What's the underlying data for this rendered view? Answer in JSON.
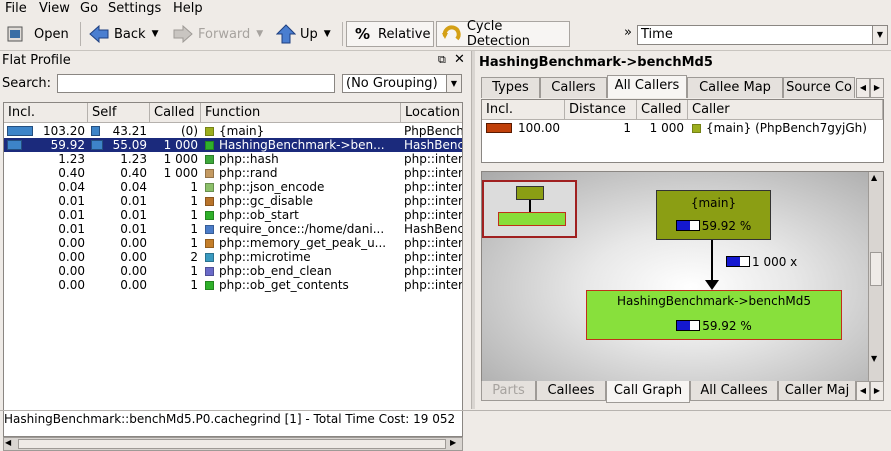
{
  "menu": [
    "File",
    "View",
    "Go",
    "Settings",
    "Help"
  ],
  "toolbar": {
    "open": "Open",
    "back": "Back",
    "forward": "Forward",
    "up": "Up",
    "relative": "Relative",
    "cycle": "Cycle Detection",
    "more": "»",
    "event_type": "Time"
  },
  "flat_profile": {
    "title": "Flat Profile",
    "search_label": "Search:",
    "search_value": "",
    "grouping": "(No Grouping)",
    "columns": [
      "Incl.",
      "Self",
      "Called",
      "Function",
      "Location"
    ],
    "rows": [
      {
        "incl": "103.20",
        "self": "43.21",
        "called": "(0)",
        "function": "{main}",
        "location": "PhpBench",
        "color": "#9cae1e",
        "incl_frac": 1.0,
        "self_frac": 0.42
      },
      {
        "incl": "59.92",
        "self": "55.09",
        "called": "1 000",
        "function": "HashingBenchmark->ben...",
        "location": "HashBench",
        "color": "#2fb02a",
        "incl_frac": 0.58,
        "self_frac": 0.53
      },
      {
        "incl": "1.23",
        "self": "1.23",
        "called": "1 000",
        "function": "php::hash",
        "location": "php::inter",
        "color": "#3da83a",
        "incl_frac": 0,
        "self_frac": 0
      },
      {
        "incl": "0.40",
        "self": "0.40",
        "called": "1 000",
        "function": "php::rand",
        "location": "php::inter",
        "color": "#c49a62",
        "incl_frac": 0,
        "self_frac": 0
      },
      {
        "incl": "0.04",
        "self": "0.04",
        "called": "1",
        "function": "php::json_encode",
        "location": "php::inter",
        "color": "#8cc06a",
        "incl_frac": 0,
        "self_frac": 0
      },
      {
        "incl": "0.01",
        "self": "0.01",
        "called": "1",
        "function": "php::gc_disable",
        "location": "php::inter",
        "color": "#b8732a",
        "incl_frac": 0,
        "self_frac": 0
      },
      {
        "incl": "0.01",
        "self": "0.01",
        "called": "1",
        "function": "php::ob_start",
        "location": "php::inter",
        "color": "#2fb02a",
        "incl_frac": 0,
        "self_frac": 0
      },
      {
        "incl": "0.01",
        "self": "0.01",
        "called": "1",
        "function": "require_once::/home/dani...",
        "location": "HashBench",
        "color": "#4a7cc8",
        "incl_frac": 0,
        "self_frac": 0
      },
      {
        "incl": "0.00",
        "self": "0.00",
        "called": "1",
        "function": "php::memory_get_peak_u...",
        "location": "php::inter",
        "color": "#c47e2a",
        "incl_frac": 0,
        "self_frac": 0
      },
      {
        "incl": "0.00",
        "self": "0.00",
        "called": "2",
        "function": "php::microtime",
        "location": "php::inter",
        "color": "#3a9ac0",
        "incl_frac": 0,
        "self_frac": 0
      },
      {
        "incl": "0.00",
        "self": "0.00",
        "called": "1",
        "function": "php::ob_end_clean",
        "location": "php::inter",
        "color": "#6a6ac8",
        "incl_frac": 0,
        "self_frac": 0
      },
      {
        "incl": "0.00",
        "self": "0.00",
        "called": "1",
        "function": "php::ob_get_contents",
        "location": "php::inter",
        "color": "#2fb02a",
        "incl_frac": 0,
        "self_frac": 0
      }
    ]
  },
  "detail": {
    "title": "HashingBenchmark->benchMd5",
    "tabs": [
      "Types",
      "Callers",
      "All Callers",
      "Callee Map",
      "Source Co"
    ],
    "columns": [
      "Incl.",
      "Distance",
      "Called",
      "Caller"
    ],
    "caller_row": {
      "incl": "100.00",
      "distance": "1",
      "called": "1 000",
      "caller": "{main} (PhpBench7gyjGh)",
      "color": "#9cae1e",
      "bar_color": "#c0400a"
    },
    "graph": {
      "main_label": "{main}",
      "main_pct": "59.92 %",
      "main_fill": 0.6,
      "edge_label": "1 000 x",
      "edge_fill": 0.6,
      "child_label": "HashingBenchmark->benchMd5",
      "child_pct": "59.92 %",
      "child_fill": 0.6
    },
    "bottom_tabs": [
      "Parts",
      "Callees",
      "Call Graph",
      "All Callees",
      "Caller Maj"
    ]
  },
  "status": "HashingBenchmark::benchMd5.P0.cachegrind [1] - Total Time Cost: 19 052"
}
